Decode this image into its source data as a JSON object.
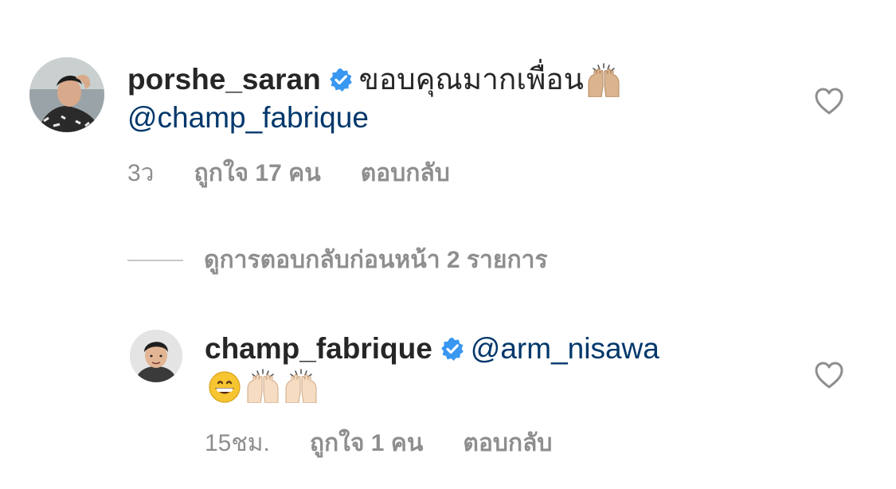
{
  "comments": [
    {
      "username": "porshe_saran",
      "verified": true,
      "text": "ขอบคุณมากเพื่อน",
      "emojis": [
        "raising-hands"
      ],
      "mention": "@champ_fabrique",
      "time": "3ว",
      "likes": "ถูกใจ 17 คน",
      "reply": "ตอบกลับ"
    },
    {
      "username": "champ_fabrique",
      "verified": true,
      "mention": "@arm_nisawa",
      "emojis": [
        "grinning-face",
        "raising-hands",
        "raising-hands"
      ],
      "time": "15ชม.",
      "likes": "ถูกใจ 1 คน",
      "reply": "ตอบกลับ"
    }
  ],
  "view_previous_replies": "ดูการตอบกลับก่อนหน้า 2 รายการ",
  "colors": {
    "username": "#262626",
    "mention": "#00376b",
    "meta": "#8e8e8e",
    "verified": "#3897f0"
  },
  "icons": [
    "verified-badge-icon",
    "heart-outline-icon",
    "raising-hands-emoji",
    "grinning-face-emoji"
  ]
}
